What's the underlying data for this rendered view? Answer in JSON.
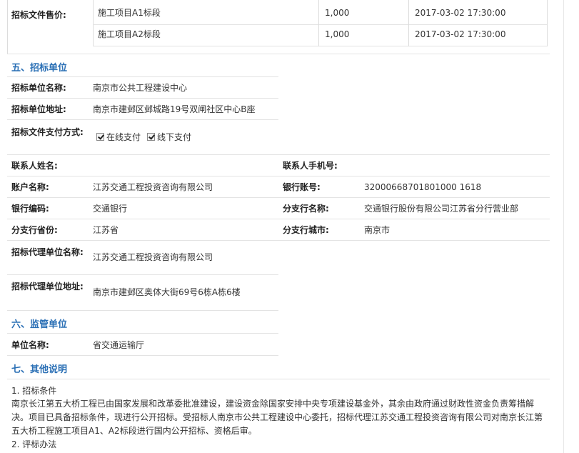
{
  "sale": {
    "label": "招标文件售价:",
    "rows": [
      {
        "name": "施工项目A1标段",
        "price": "1,000",
        "time": "2017-03-02 17:30:00"
      },
      {
        "name": "施工项目A2标段",
        "price": "1,000",
        "time": "2017-03-02 17:30:00"
      }
    ]
  },
  "section5": {
    "title": "五、招标单位",
    "unit_name_label": "招标单位名称:",
    "unit_name": "南京市公共工程建设中心",
    "unit_addr_label": "招标单位地址:",
    "unit_addr": "南京市建邺区邺城路19号双闸社区中心B座",
    "pay_label": "招标文件支付方式:",
    "pay_options": [
      "在线支付",
      "线下支付"
    ],
    "contact_label": "联系人姓名:",
    "contact": "",
    "mobile_label": "联系人手机号:",
    "mobile": "",
    "account_name_label": "账户名称:",
    "account_name": "江苏交通工程投资咨询有限公司",
    "bank_account_label": "银行账号:",
    "bank_account": "32000668701801000 1618",
    "bank_code_label": "银行编码:",
    "bank_code": "交通银行",
    "branch_name_label": "分支行名称:",
    "branch_name": "交通银行股份有限公司江苏省分行营业部",
    "branch_province_label": "分支行省份:",
    "branch_province": "江苏省",
    "branch_city_label": "分支行城市:",
    "branch_city": "南京市",
    "agent_name_label": "招标代理单位名称:",
    "agent_name": "江苏交通工程投资咨询有限公司",
    "agent_addr_label": "招标代理单位地址:",
    "agent_addr": "南京市建邺区奥体大街69号6栋A栋6楼"
  },
  "section6": {
    "title": "六、监管单位",
    "unit_label": "单位名称:",
    "unit": "省交通运输厅"
  },
  "section7": {
    "title": "七、其他说明",
    "item1_title": "1. 招标条件",
    "item1_text": "南京长江第五大桥工程已由国家发展和改革委批准建设，建设资金除国家安排中央专项建设基金外，其余由政府通过财政性资金负责筹措解决。项目已具备招标条件，现进行公开招标。受招标人南京市公共工程建设中心委托，招标代理江苏交通工程投资咨询有限公司对南京长江第五大桥工程施工项目A1、A2标段进行国内公开招标、资格后审。",
    "item2_title": "2. 评标办法"
  }
}
